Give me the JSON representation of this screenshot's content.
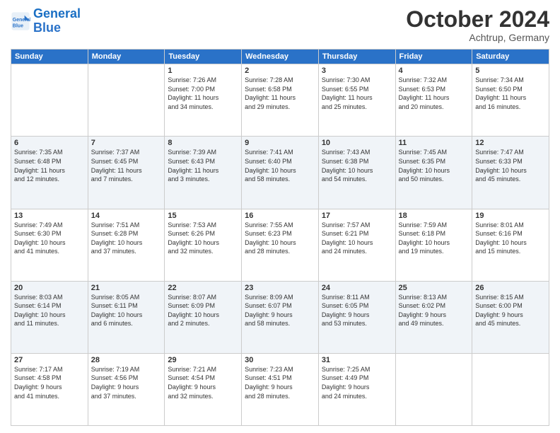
{
  "header": {
    "logo_line1": "General",
    "logo_line2": "Blue",
    "month": "October 2024",
    "location": "Achtrup, Germany"
  },
  "days_of_week": [
    "Sunday",
    "Monday",
    "Tuesday",
    "Wednesday",
    "Thursday",
    "Friday",
    "Saturday"
  ],
  "weeks": [
    [
      {
        "day": "",
        "info": ""
      },
      {
        "day": "",
        "info": ""
      },
      {
        "day": "1",
        "info": "Sunrise: 7:26 AM\nSunset: 7:00 PM\nDaylight: 11 hours\nand 34 minutes."
      },
      {
        "day": "2",
        "info": "Sunrise: 7:28 AM\nSunset: 6:58 PM\nDaylight: 11 hours\nand 29 minutes."
      },
      {
        "day": "3",
        "info": "Sunrise: 7:30 AM\nSunset: 6:55 PM\nDaylight: 11 hours\nand 25 minutes."
      },
      {
        "day": "4",
        "info": "Sunrise: 7:32 AM\nSunset: 6:53 PM\nDaylight: 11 hours\nand 20 minutes."
      },
      {
        "day": "5",
        "info": "Sunrise: 7:34 AM\nSunset: 6:50 PM\nDaylight: 11 hours\nand 16 minutes."
      }
    ],
    [
      {
        "day": "6",
        "info": "Sunrise: 7:35 AM\nSunset: 6:48 PM\nDaylight: 11 hours\nand 12 minutes."
      },
      {
        "day": "7",
        "info": "Sunrise: 7:37 AM\nSunset: 6:45 PM\nDaylight: 11 hours\nand 7 minutes."
      },
      {
        "day": "8",
        "info": "Sunrise: 7:39 AM\nSunset: 6:43 PM\nDaylight: 11 hours\nand 3 minutes."
      },
      {
        "day": "9",
        "info": "Sunrise: 7:41 AM\nSunset: 6:40 PM\nDaylight: 10 hours\nand 58 minutes."
      },
      {
        "day": "10",
        "info": "Sunrise: 7:43 AM\nSunset: 6:38 PM\nDaylight: 10 hours\nand 54 minutes."
      },
      {
        "day": "11",
        "info": "Sunrise: 7:45 AM\nSunset: 6:35 PM\nDaylight: 10 hours\nand 50 minutes."
      },
      {
        "day": "12",
        "info": "Sunrise: 7:47 AM\nSunset: 6:33 PM\nDaylight: 10 hours\nand 45 minutes."
      }
    ],
    [
      {
        "day": "13",
        "info": "Sunrise: 7:49 AM\nSunset: 6:30 PM\nDaylight: 10 hours\nand 41 minutes."
      },
      {
        "day": "14",
        "info": "Sunrise: 7:51 AM\nSunset: 6:28 PM\nDaylight: 10 hours\nand 37 minutes."
      },
      {
        "day": "15",
        "info": "Sunrise: 7:53 AM\nSunset: 6:26 PM\nDaylight: 10 hours\nand 32 minutes."
      },
      {
        "day": "16",
        "info": "Sunrise: 7:55 AM\nSunset: 6:23 PM\nDaylight: 10 hours\nand 28 minutes."
      },
      {
        "day": "17",
        "info": "Sunrise: 7:57 AM\nSunset: 6:21 PM\nDaylight: 10 hours\nand 24 minutes."
      },
      {
        "day": "18",
        "info": "Sunrise: 7:59 AM\nSunset: 6:18 PM\nDaylight: 10 hours\nand 19 minutes."
      },
      {
        "day": "19",
        "info": "Sunrise: 8:01 AM\nSunset: 6:16 PM\nDaylight: 10 hours\nand 15 minutes."
      }
    ],
    [
      {
        "day": "20",
        "info": "Sunrise: 8:03 AM\nSunset: 6:14 PM\nDaylight: 10 hours\nand 11 minutes."
      },
      {
        "day": "21",
        "info": "Sunrise: 8:05 AM\nSunset: 6:11 PM\nDaylight: 10 hours\nand 6 minutes."
      },
      {
        "day": "22",
        "info": "Sunrise: 8:07 AM\nSunset: 6:09 PM\nDaylight: 10 hours\nand 2 minutes."
      },
      {
        "day": "23",
        "info": "Sunrise: 8:09 AM\nSunset: 6:07 PM\nDaylight: 9 hours\nand 58 minutes."
      },
      {
        "day": "24",
        "info": "Sunrise: 8:11 AM\nSunset: 6:05 PM\nDaylight: 9 hours\nand 53 minutes."
      },
      {
        "day": "25",
        "info": "Sunrise: 8:13 AM\nSunset: 6:02 PM\nDaylight: 9 hours\nand 49 minutes."
      },
      {
        "day": "26",
        "info": "Sunrise: 8:15 AM\nSunset: 6:00 PM\nDaylight: 9 hours\nand 45 minutes."
      }
    ],
    [
      {
        "day": "27",
        "info": "Sunrise: 7:17 AM\nSunset: 4:58 PM\nDaylight: 9 hours\nand 41 minutes."
      },
      {
        "day": "28",
        "info": "Sunrise: 7:19 AM\nSunset: 4:56 PM\nDaylight: 9 hours\nand 37 minutes."
      },
      {
        "day": "29",
        "info": "Sunrise: 7:21 AM\nSunset: 4:54 PM\nDaylight: 9 hours\nand 32 minutes."
      },
      {
        "day": "30",
        "info": "Sunrise: 7:23 AM\nSunset: 4:51 PM\nDaylight: 9 hours\nand 28 minutes."
      },
      {
        "day": "31",
        "info": "Sunrise: 7:25 AM\nSunset: 4:49 PM\nDaylight: 9 hours\nand 24 minutes."
      },
      {
        "day": "",
        "info": ""
      },
      {
        "day": "",
        "info": ""
      }
    ]
  ]
}
